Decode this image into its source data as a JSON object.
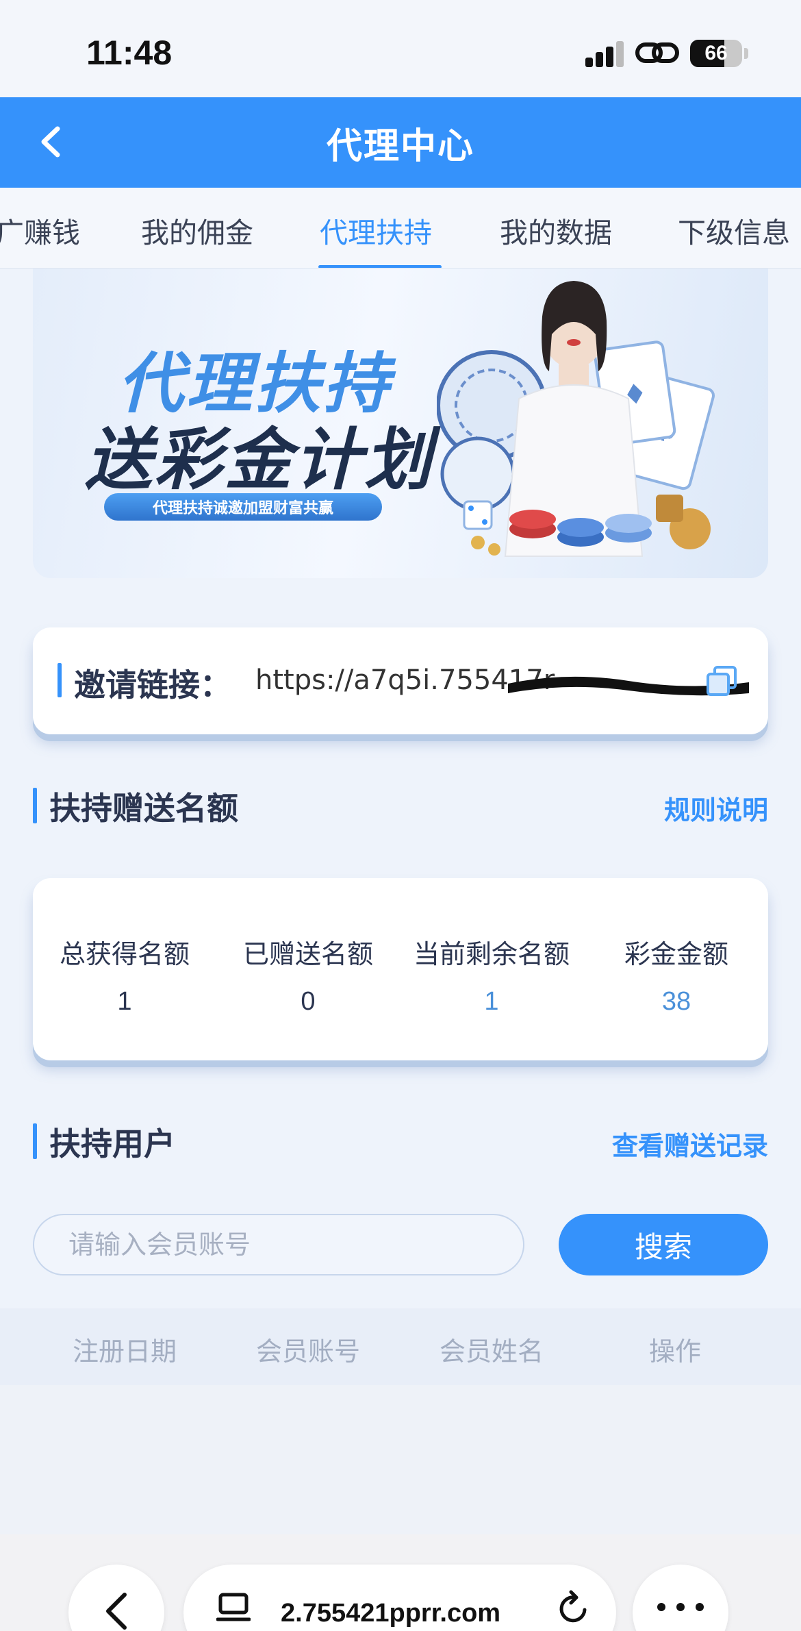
{
  "status_bar": {
    "time": "11:48",
    "battery": "66",
    "battery_level": 0.66
  },
  "header": {
    "title": "代理中心"
  },
  "tabs": [
    {
      "label": "广赚钱",
      "active": false
    },
    {
      "label": "我的佣金",
      "active": false
    },
    {
      "label": "代理扶持",
      "active": true
    },
    {
      "label": "我的数据",
      "active": false
    },
    {
      "label": "下级信息",
      "active": false
    }
  ],
  "banner": {
    "title_line1": "代理扶持",
    "title_line2": "送彩金计划",
    "subtitle": "代理扶持诚邀加盟财富共赢"
  },
  "invite": {
    "label": "邀请链接：",
    "url": "https://a7q5i.755417r"
  },
  "quota_section": {
    "title": "扶持赠送名额",
    "link": "规则说明"
  },
  "stats": [
    {
      "label": "总获得名额",
      "value": "1"
    },
    {
      "label": "已赠送名额",
      "value": "0"
    },
    {
      "label": "当前剩余名额",
      "value": "1"
    },
    {
      "label": "彩金金额",
      "value": "38"
    }
  ],
  "users_section": {
    "title": "扶持用户",
    "link": "查看赠送记录"
  },
  "search": {
    "placeholder": "请输入会员账号",
    "value": "",
    "button": "搜索"
  },
  "table": {
    "headers": [
      "注册日期",
      "会员账号",
      "会员姓名",
      "操作"
    ]
  },
  "browser": {
    "url": "2.755421pprr.com"
  },
  "colors": {
    "primary": "#3592fb",
    "text": "#2b3550",
    "value_accent": "#4a90d9"
  }
}
